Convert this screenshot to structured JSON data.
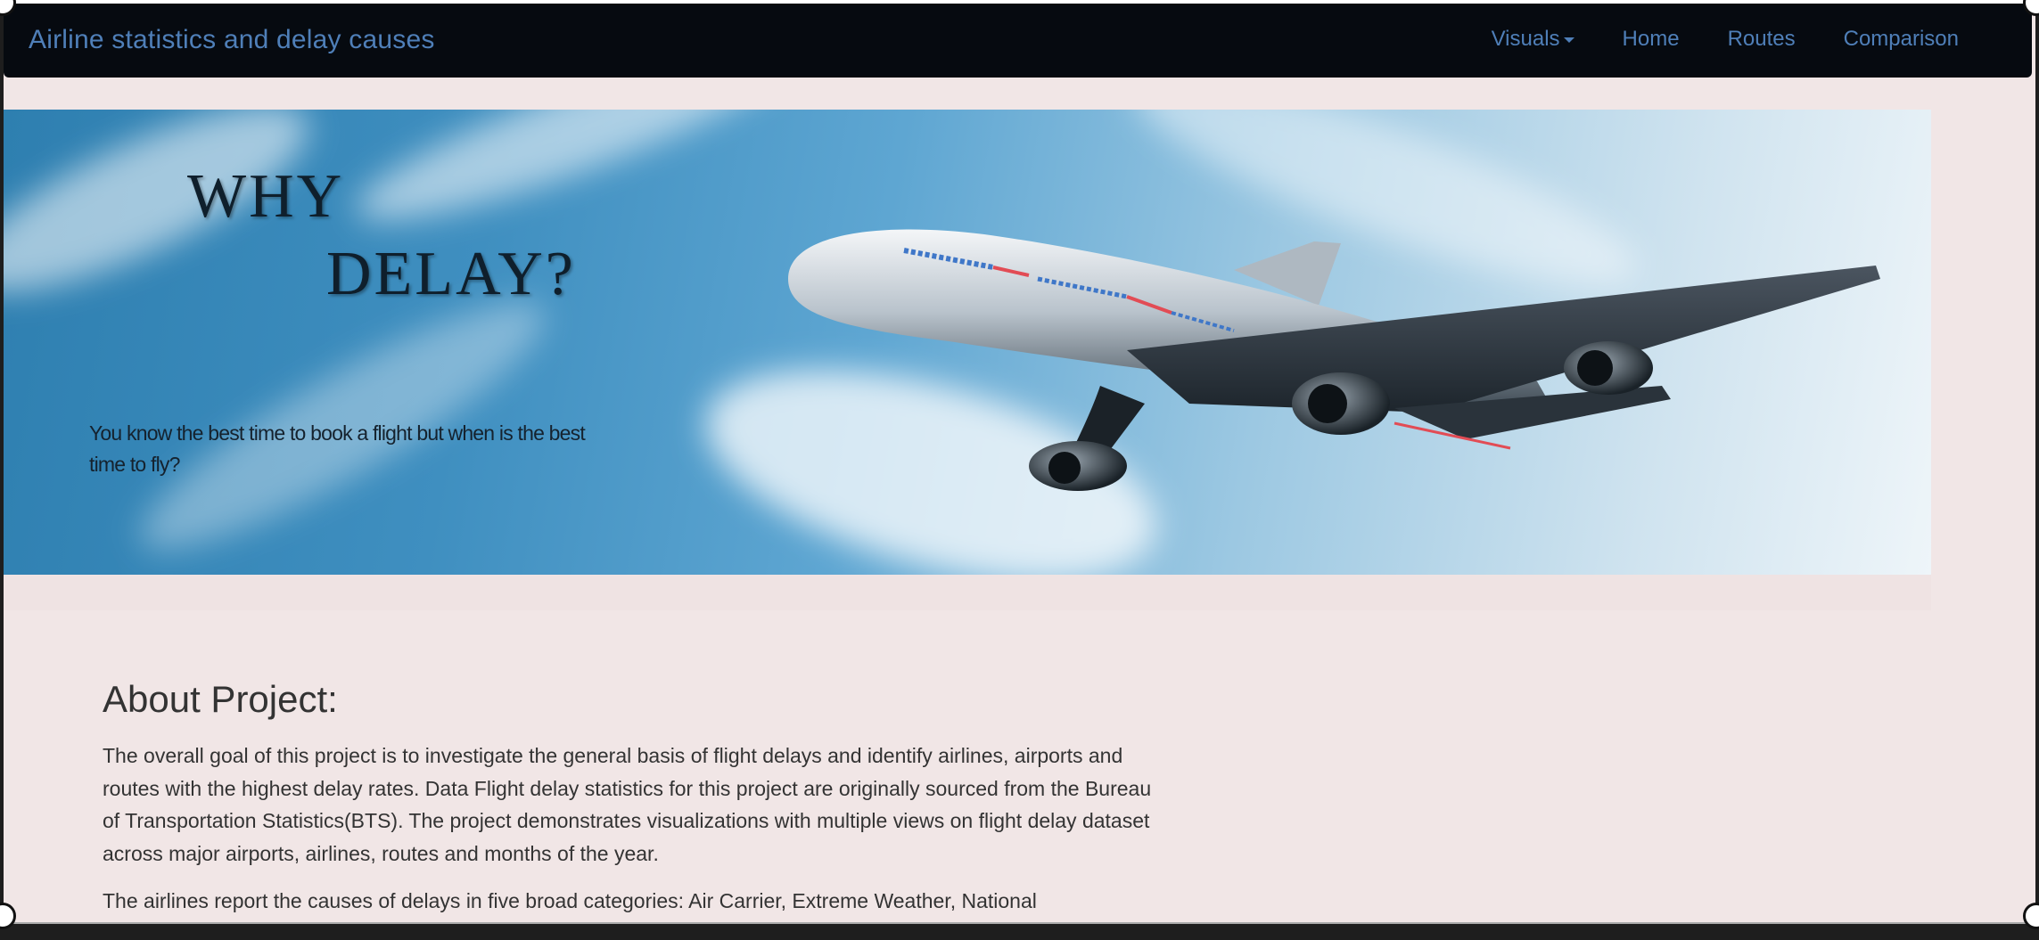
{
  "navbar": {
    "brand": "Airline statistics and delay causes",
    "links": [
      "Visuals",
      "Home",
      "Routes",
      "Comparison"
    ]
  },
  "hero": {
    "line1": "WHY",
    "line2": "DELAY?",
    "tagline": "You know the best time to book a flight but when is the best time to fly?"
  },
  "about": {
    "title": "About Project:",
    "paragraph1": "The overall goal of this project is to investigate the general basis of flight delays and identify airlines, airports and routes with the highest delay rates. Data Flight delay statistics for this project are originally sourced from the Bureau of Transportation Statistics(BTS). The project demonstrates visualizations with multiple views on flight delay dataset across major airports, airlines, routes and months of the year.",
    "paragraph2": "The airlines report the causes of delays in five broad categories: Air Carrier, Extreme Weather, National"
  },
  "colors": {
    "navbar_bg": "#060a10",
    "nav_link": "#4f7fb8",
    "page_bg": "#f1e6e6",
    "body_text": "#333333"
  }
}
